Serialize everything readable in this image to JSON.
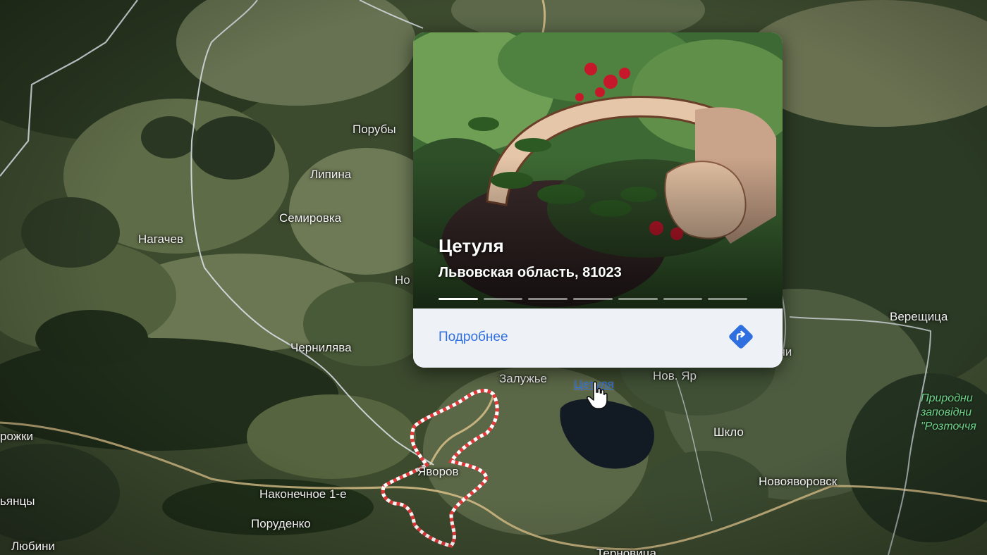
{
  "map": {
    "places": [
      {
        "name": "Порубы"
      },
      {
        "name": "Липина"
      },
      {
        "name": "Семировка"
      },
      {
        "name": "Нагачев"
      },
      {
        "name": "Чернилява"
      },
      {
        "name": "Залужье"
      },
      {
        "name": "Цетуля"
      },
      {
        "name": "Нов. Яр"
      },
      {
        "name": "Шкло"
      },
      {
        "name": "Верещица"
      },
      {
        "name": "Новояворовск"
      },
      {
        "name": "Яворов"
      },
      {
        "name": "Наконечное 1-е"
      },
      {
        "name": "Поруденко"
      },
      {
        "name": "Любини"
      },
      {
        "name": "рожки"
      },
      {
        "name": "ьянцы"
      },
      {
        "name": "ричи"
      },
      {
        "name": "Но"
      },
      {
        "name": "Терновица"
      }
    ],
    "reserve_label": [
      "Природни",
      "заповідни",
      "\"Розточчя"
    ]
  },
  "card": {
    "title": "Цетуля",
    "subtitle": "Львовская область, 81023",
    "photo_count": 7,
    "active_photo": 1,
    "more_label": "Подробнее",
    "directions_icon": "directions-icon"
  },
  "colors": {
    "accent": "#2f6fe0",
    "boundary": "#e23a3a",
    "road": "#d8c088"
  }
}
